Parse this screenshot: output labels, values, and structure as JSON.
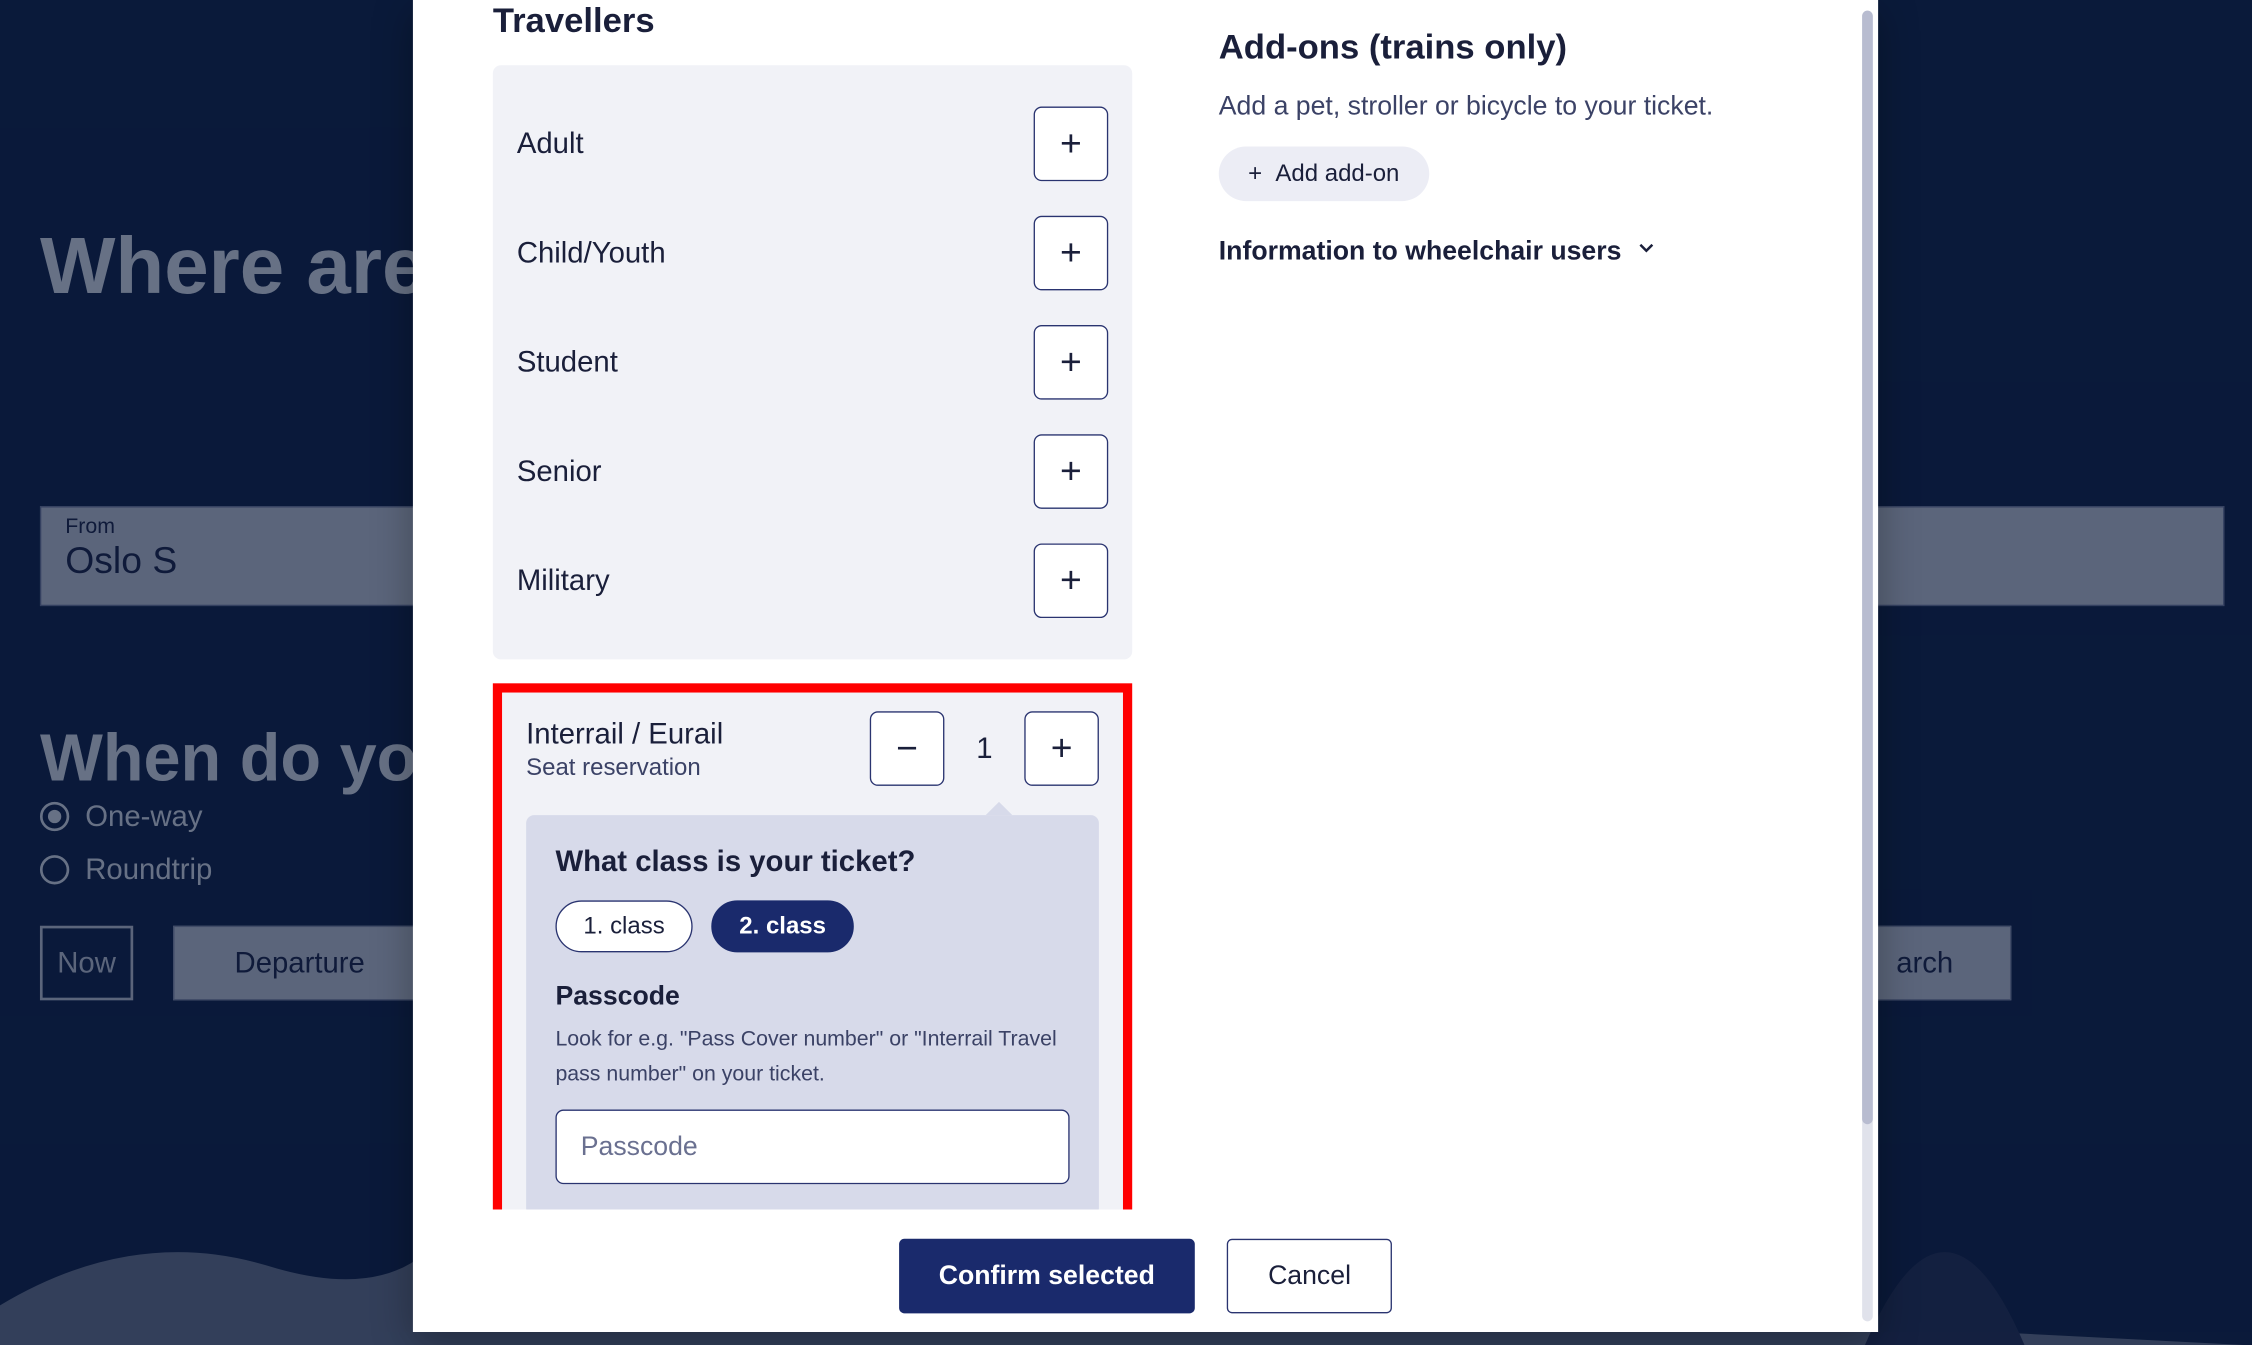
{
  "background": {
    "heading1": "Where are y",
    "heading2": "When do you w",
    "from_label": "From",
    "from_value": "Oslo S",
    "radio_oneway": "One-way",
    "radio_roundtrip": "Roundtrip",
    "now_button": "Now",
    "departure_button": "Departure",
    "search_button": "arch"
  },
  "modal": {
    "travellers_title": "Travellers",
    "types": [
      {
        "label": "Adult"
      },
      {
        "label": "Child/Youth"
      },
      {
        "label": "Student"
      },
      {
        "label": "Senior"
      },
      {
        "label": "Military"
      }
    ],
    "interrail": {
      "title": "Interrail / Eurail",
      "subtitle": "Seat reservation",
      "count": "1",
      "class_question": "What class is your ticket?",
      "class1_label": "1. class",
      "class2_label": "2. class",
      "passcode_label": "Passcode",
      "passcode_help": "Look for e.g. \"Pass Cover number\" or \"Interrail Travel pass number\" on your ticket.",
      "passcode_placeholder": "Passcode"
    },
    "addons": {
      "title": "Add-ons (trains only)",
      "subtitle": "Add a pet, stroller or bicycle to your ticket.",
      "button_label": "Add add-on",
      "wheelchair_label": "Information to wheelchair users"
    },
    "footer": {
      "confirm": "Confirm selected",
      "cancel": "Cancel"
    }
  }
}
